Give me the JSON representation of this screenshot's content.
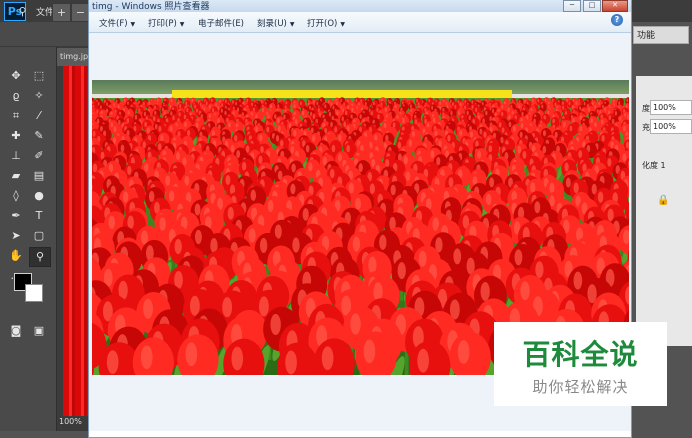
{
  "photoshop": {
    "logo": "Ps",
    "menus": [
      "文件(F)",
      "编"
    ],
    "doc_tab": "timg.jp",
    "zoom_status": "100%",
    "workspace": "功能",
    "panel": {
      "opacity_label": "度:",
      "opacity_value": "100%",
      "fill_label": "充:",
      "fill_value": "100%",
      "saturation_text": "化度 1"
    }
  },
  "viewer": {
    "title": "timg - Windows 照片查看器",
    "menus": [
      {
        "label": "文件(F)"
      },
      {
        "label": "打印(P)"
      },
      {
        "label": "电子邮件(E)"
      },
      {
        "label": "刻录(U)"
      },
      {
        "label": "打开(O)"
      }
    ],
    "window_buttons": {
      "minimize": "─",
      "maximize": "□",
      "close": "✕"
    },
    "help": "?"
  },
  "watermark": {
    "title": "百科全说",
    "subtitle": "助你轻松解决"
  },
  "colors": {
    "tulip_red": "#e80f0f",
    "leaf_green": "#3c8a22",
    "accent_blue": "#1f5fb0",
    "brand_green": "#1e8a3b"
  }
}
